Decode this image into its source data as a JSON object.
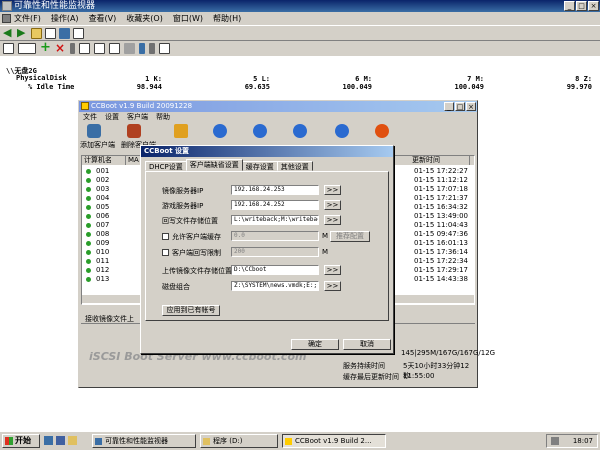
{
  "perfmon": {
    "title": "可靠性和性能监视器",
    "menu": [
      "文件(F)",
      "操作(A)",
      "查看(V)",
      "收藏夹(O)",
      "窗口(W)",
      "帮助(H)"
    ],
    "report": {
      "object": "\\\\无盘2G",
      "counter_group": "PhysicalDisk",
      "counter": "% Idle Time",
      "instances": [
        "1 K:",
        "5 L:",
        "6 M:",
        "7 M:",
        "8 Z:"
      ],
      "values": [
        "98.944",
        "69.635",
        "100.049",
        "100.049",
        "99.970"
      ]
    }
  },
  "ccboot": {
    "title": "CCBoot v1.9 Build 20091228",
    "menu": [
      "文件",
      "设置",
      "客户端",
      "帮助"
    ],
    "tools": [
      "添加客户端",
      "删除客户端"
    ],
    "list_headers": [
      "计算机名",
      "MA",
      "更新时间"
    ],
    "clients": [
      {
        "name": "001",
        "time": "01-15 17:22:27"
      },
      {
        "name": "002",
        "time": "01-15 11:12:12"
      },
      {
        "name": "003",
        "time": "01-15 17:07:18"
      },
      {
        "name": "004",
        "time": "01-15 17:21:37"
      },
      {
        "name": "005",
        "time": "01-15 16:34:32"
      },
      {
        "name": "006",
        "time": "01-15 13:49:00"
      },
      {
        "name": "007",
        "time": "01-15 11:04:43"
      },
      {
        "name": "008",
        "time": "01-15 09:47:36"
      },
      {
        "name": "009",
        "time": "01-15 16:01:13"
      },
      {
        "name": "010",
        "time": "01-15 17:36:14"
      },
      {
        "name": "011",
        "time": "01-15 17:22:34"
      },
      {
        "name": "012",
        "time": "01-15 17:29:17"
      },
      {
        "name": "013",
        "time": "01-15 14:43:38"
      }
    ],
    "status_label": "接收镜像文件上",
    "watermark": "iSCSI Boot Server  www.ccboot.com",
    "disk_info": "145|295M/167G/167G/12G",
    "run_time_label": "服务持续时间",
    "run_time": "5天10小时33分钟12秒",
    "refresh_label": "缓存最后更新时间",
    "refresh_time": "11:55:00"
  },
  "dialog": {
    "title": "CCBoot 设置",
    "tabs": [
      "DHCP设置",
      "客户端缺省设置",
      "缓存设置",
      "其他设置"
    ],
    "fields": {
      "image_server_label": "镜像服务器IP",
      "image_server": "192.168.24.253",
      "game_server_label": "游戏服务器IP",
      "game_server": "192.168.24.252",
      "writeback_label": "回写文件存储位置",
      "writeback": "L:\\writeback;M:\\writeback",
      "allow_cache_label": "允许客户端缓存",
      "cache_value": "0.0",
      "cache_config": "推荐配置",
      "writeback_limit_label": "客户端回写限制",
      "limit_value": "200",
      "upload_label": "上传镜像文件存储位置",
      "upload": "D:\\CCboot",
      "disk_label": "磁盘组合",
      "disk": "Z:\\SYSTEM\\news.vmdk;E:;",
      "apply_all": "应用到已有帐号",
      "browse": ">>",
      "mb": "M"
    },
    "ok": "确定",
    "cancel": "取消"
  },
  "taskbar": {
    "start": "开始",
    "tasks": [
      "可靠性和性能监视器",
      "程序 (D:)",
      "CCBoot v1.9 Build 2..."
    ],
    "clock": "18:07"
  }
}
